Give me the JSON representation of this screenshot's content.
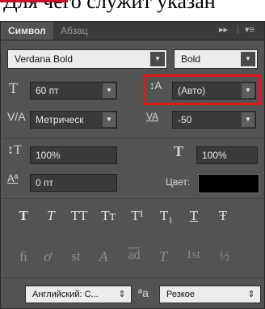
{
  "caption": {
    "text": "Для чего служит указан"
  },
  "tabs": [
    {
      "label": "Символ"
    },
    {
      "label": "Абзац"
    }
  ],
  "panel_controls": {
    "collapse": "▸▸",
    "menu": "▾≡"
  },
  "font": {
    "family": "Verdana Bold",
    "style": "Bold"
  },
  "size": {
    "value": "60 пт"
  },
  "leading": {
    "value": "(Авто)"
  },
  "kerning": {
    "value": "Метрическ"
  },
  "tracking": {
    "value": "-50"
  },
  "vscale": {
    "value": "100%"
  },
  "hscale": {
    "value": "100%"
  },
  "baseline": {
    "value": "0 пт"
  },
  "color": {
    "label": "Цвет:",
    "value": "#000000"
  },
  "style_buttons": [
    "T",
    "T",
    "TT",
    "Tт",
    "T¹",
    "T₁",
    "T",
    "Ŧ"
  ],
  "ot_buttons": [
    "ﬁ",
    "ơ",
    "st",
    "A",
    "ad",
    "T",
    "1st",
    "½"
  ],
  "language": {
    "value": "Английский: С..."
  },
  "aa_icon": "ªa",
  "antialias": {
    "value": "Резкое"
  }
}
